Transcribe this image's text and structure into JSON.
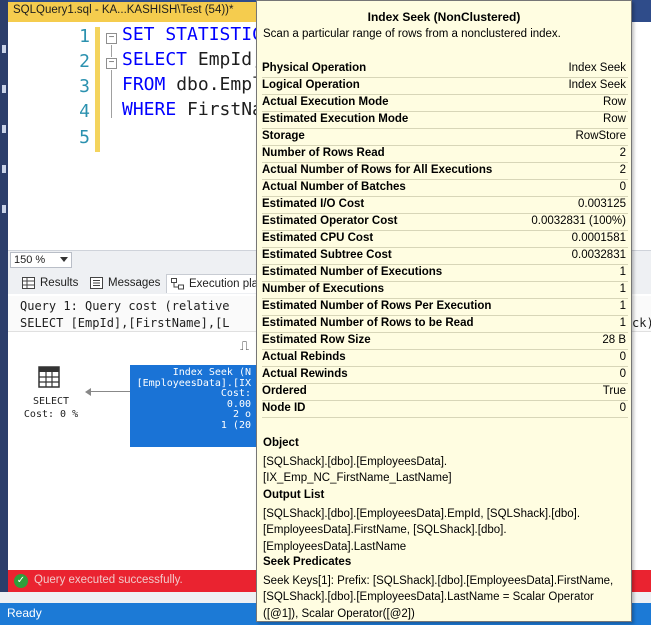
{
  "tab": {
    "title": "SQLQuery1.sql - KA...KASHISH\\Test (54))*",
    "close": "✕"
  },
  "editor": {
    "lines": [
      {
        "num": "1",
        "kw": "SET STATISTIC",
        "rest": ""
      },
      {
        "num": "2",
        "kw": "SELECT",
        "rest": " EmpId,"
      },
      {
        "num": "3",
        "kw": "FROM",
        "rest": " dbo.",
        "tail": "Empl"
      },
      {
        "num": "4",
        "kw": "WHERE",
        "rest": " FirstNa"
      },
      {
        "num": "5",
        "kw": "",
        "rest": ""
      }
    ]
  },
  "zoom": {
    "value": "150 %"
  },
  "result_tabs": [
    {
      "label": "Results",
      "icon": "grid-icon"
    },
    {
      "label": "Messages",
      "icon": "messages-icon"
    },
    {
      "label": "Execution pla",
      "icon": "execution-plan-icon"
    }
  ],
  "plan": {
    "query_line1": "Query 1: Query cost (relative",
    "query_line2": "SELECT [EmpId],[FirstName],[L",
    "query_tail": "ck)",
    "select_label": "SELECT",
    "select_cost": "Cost: 0 %",
    "seek_lines": [
      "Index Seek (N",
      "[EmployeesData].[IX",
      "Cost:",
      "0.00",
      "2 o",
      "1 (20"
    ]
  },
  "error": {
    "text": "Query executed successfully."
  },
  "status": {
    "text": "Ready"
  },
  "tooltip": {
    "title": "Index Seek (NonClustered)",
    "description": "Scan a particular range of rows from a nonclustered index.",
    "rows": [
      {
        "k": "Physical Operation",
        "v": "Index Seek"
      },
      {
        "k": "Logical Operation",
        "v": "Index Seek"
      },
      {
        "k": "Actual Execution Mode",
        "v": "Row"
      },
      {
        "k": "Estimated Execution Mode",
        "v": "Row"
      },
      {
        "k": "Storage",
        "v": "RowStore"
      },
      {
        "k": "Number of Rows Read",
        "v": "2"
      },
      {
        "k": "Actual Number of Rows for All Executions",
        "v": "2"
      },
      {
        "k": "Actual Number of Batches",
        "v": "0"
      },
      {
        "k": "Estimated I/O Cost",
        "v": "0.003125"
      },
      {
        "k": "Estimated Operator Cost",
        "v": "0.0032831 (100%)"
      },
      {
        "k": "Estimated CPU Cost",
        "v": "0.0001581"
      },
      {
        "k": "Estimated Subtree Cost",
        "v": "0.0032831"
      },
      {
        "k": "Estimated Number of Executions",
        "v": "1"
      },
      {
        "k": "Number of Executions",
        "v": "1"
      },
      {
        "k": "Estimated Number of Rows Per Execution",
        "v": "1"
      },
      {
        "k": "Estimated Number of Rows to be Read",
        "v": "1"
      },
      {
        "k": "Estimated Row Size",
        "v": "28 B"
      },
      {
        "k": "Actual Rebinds",
        "v": "0"
      },
      {
        "k": "Actual Rewinds",
        "v": "0"
      },
      {
        "k": "Ordered",
        "v": "True"
      },
      {
        "k": "Node ID",
        "v": "0"
      }
    ],
    "object_h": "Object",
    "object_v": "[SQLShack].[dbo].[EmployeesData].\n[IX_Emp_NC_FirstName_LastName]",
    "output_h": "Output List",
    "output_v": "[SQLShack].[dbo].[EmployeesData].EmpId, [SQLShack].[dbo].\n[EmployeesData].FirstName, [SQLShack].[dbo].\n[EmployeesData].LastName",
    "seek_h": "Seek Predicates",
    "seek_v": "Seek Keys[1]: Prefix: [SQLShack].[dbo].[EmployeesData].FirstName,\n[SQLShack].[dbo].[EmployeesData].LastName = Scalar Operator\n([@1]), Scalar Operator([@2])"
  },
  "colors": {
    "status": "#1c7ad6",
    "error": "#ea2330",
    "tab_active": "#f5cc4e",
    "seek_box": "#1a73d6",
    "tooltip_bg": "#fffde1"
  }
}
